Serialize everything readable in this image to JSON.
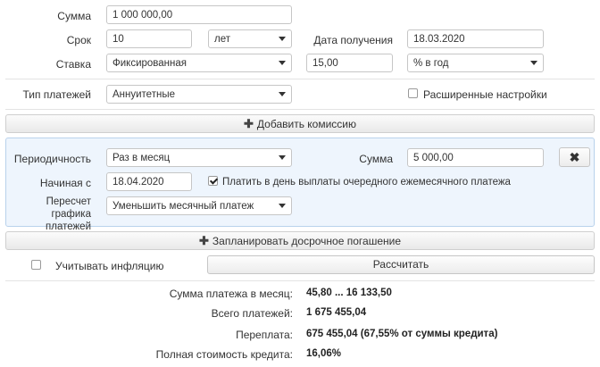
{
  "form": {
    "sum_label": "Сумма",
    "sum_value": "1 000 000,00",
    "term_label": "Срок",
    "term_value": "10",
    "term_unit": "лет",
    "receive_date_label": "Дата получения",
    "receive_date_value": "18.03.2020",
    "rate_label": "Ставка",
    "rate_type": "Фиксированная",
    "rate_value": "15,00",
    "rate_unit": "% в год",
    "payment_type_label": "Тип платежей",
    "payment_type_value": "Аннуитетные",
    "advanced_settings_label": "Расширенные настройки",
    "advanced_settings_checked": false
  },
  "add_commission_label": "Добавить комиссию",
  "early_repayment": {
    "periodicity_label": "Периодичность",
    "periodicity_value": "Раз в месяц",
    "sum_label": "Сумма",
    "sum_value": "5 000,00",
    "start_label": "Начиная с",
    "start_value": "18.04.2020",
    "pay_on_day_label": "Платить в день выплаты очередного ежемесячного платежа",
    "pay_on_day_checked": true,
    "recalc_label_line1": "Пересчет графика",
    "recalc_label_line2": "платежей",
    "recalc_value": "Уменьшить месячный платеж",
    "remove_icon": "close-icon"
  },
  "plan_early_repayment_label": "Запланировать досрочное погашение",
  "inflation_label": "Учитывать инфляцию",
  "inflation_checked": false,
  "calculate_label": "Рассчитать",
  "results": {
    "monthly_payment_label": "Сумма платежа в месяц:",
    "monthly_payment_value": "45,80 ... 16 133,50",
    "total_payments_label": "Всего платежей:",
    "total_payments_value": "1 675 455,04",
    "overpayment_label": "Переплата:",
    "overpayment_value": "675 455,04 (67,55% от суммы кредита)",
    "full_cost_label": "Полная стоимость кредита:",
    "full_cost_value": "16,06%"
  }
}
